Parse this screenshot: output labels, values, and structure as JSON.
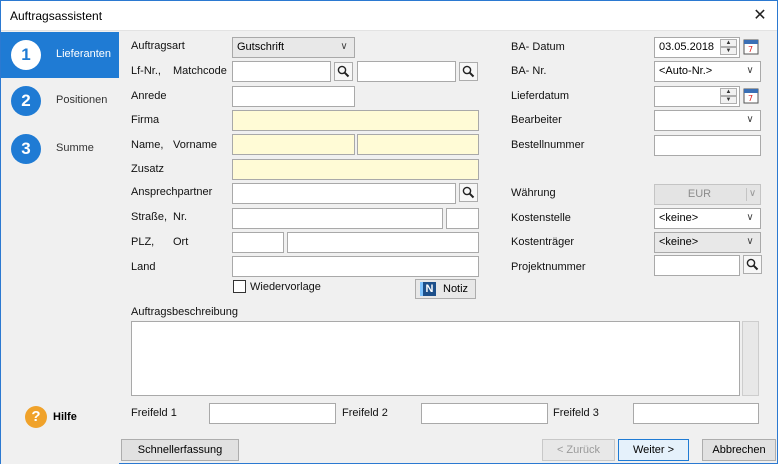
{
  "window": {
    "title": "Auftragsassistent",
    "close_glyph": "✕"
  },
  "sidebar": {
    "steps": [
      {
        "number": "1",
        "label": "Lieferanten"
      },
      {
        "number": "2",
        "label": "Positionen"
      },
      {
        "number": "3",
        "label": "Summe"
      }
    ],
    "help_glyph": "?",
    "help_label": "Hilfe"
  },
  "form": {
    "auftragsart": {
      "label": "Auftragsart",
      "value": "Gutschrift"
    },
    "lfnr": {
      "label_a": "Lf-Nr.,",
      "label_b": "Matchcode",
      "value": "",
      "matchcode": ""
    },
    "anrede": {
      "label": "Anrede",
      "value": ""
    },
    "firma": {
      "label": "Firma",
      "value": ""
    },
    "name": {
      "label_a": "Name,",
      "label_b": "Vorname",
      "name": "",
      "vorname": ""
    },
    "zusatz": {
      "label": "Zusatz",
      "value": ""
    },
    "ansprechpartner": {
      "label": "Ansprechpartner",
      "value": ""
    },
    "strasse": {
      "label_a": "Straße,",
      "label_b": "Nr.",
      "strasse": "",
      "nr": ""
    },
    "plz": {
      "label_a": "PLZ,",
      "label_b": "Ort",
      "plz": "",
      "ort": ""
    },
    "land": {
      "label": "Land",
      "value": ""
    },
    "wiedervorlage": {
      "label": "Wiedervorlage",
      "checked": false
    },
    "notiz": {
      "icon_glyph": "N",
      "label": "Notiz"
    },
    "ba_datum": {
      "label": "BA- Datum",
      "value": "03.05.2018"
    },
    "ba_nr": {
      "label": "BA- Nr.",
      "value": "<Auto-Nr.>"
    },
    "lieferdatum": {
      "label": "Lieferdatum",
      "value": ""
    },
    "bearbeiter": {
      "label": "Bearbeiter",
      "value": ""
    },
    "bestellnummer": {
      "label": "Bestellnummer",
      "value": ""
    },
    "waehrung": {
      "label": "Währung",
      "value": "EUR"
    },
    "kostenstelle": {
      "label": "Kostenstelle",
      "value": "<keine>"
    },
    "kostentraeger": {
      "label": "Kostenträger",
      "value": "<keine>"
    },
    "projektnummer": {
      "label": "Projektnummer",
      "value": ""
    },
    "auftragsbeschreibung": {
      "label": "Auftragsbeschreibung",
      "value": ""
    },
    "freifeld1": {
      "label": "Freifeld 1",
      "value": ""
    },
    "freifeld2": {
      "label": "Freifeld 2",
      "value": ""
    },
    "freifeld3": {
      "label": "Freifeld 3",
      "value": ""
    }
  },
  "footer": {
    "schnellerfassung": "Schnellerfassung",
    "zurueck": "< Zurück",
    "weiter": "Weiter >",
    "abbrechen": "Abbrechen"
  },
  "colors": {
    "accent": "#1f7bd4",
    "required_field": "#fffbd6",
    "help": "#f0a22a"
  }
}
